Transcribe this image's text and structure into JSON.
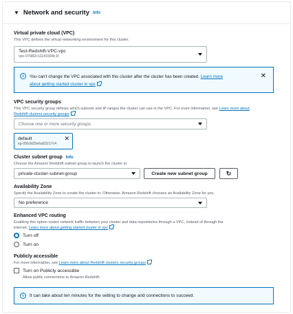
{
  "section": {
    "title": "Network and security",
    "info": "Info"
  },
  "vpc": {
    "label": "Virtual private cloud (VPC)",
    "description": "This VPC defines the virtual networking environment for this cluster.",
    "selected_name": "Test-Redshift-VPC-vpc",
    "selected_id": "vpc-07982c11141594c1f"
  },
  "vpc_alert": {
    "text": "You can't change the VPC associated with this cluster after the cluster has been created.",
    "link_line1": "Learn more",
    "link_line2": "about getting started cluster in vpc"
  },
  "security_groups": {
    "label": "VPC security groups",
    "description": "This VPC security group defines which subnets and IP ranges the cluster can use in the VPC. For more information, see",
    "link_part1": "Learn more about",
    "link_part2": "Redshift clusters security groups",
    "placeholder": "Choose one or more security groups",
    "token_name": "default",
    "token_id": "sg-05b3d25e6a83217c4"
  },
  "subnet": {
    "label": "Cluster subnet group",
    "info": "Info",
    "description": "Choose the Amazon Redshift subnet group to launch the cluster in.",
    "selected": "private-cluster-subnet-group",
    "create_button": "Create new subnet group"
  },
  "az": {
    "label": "Availability Zone",
    "description": "Specify the Availability Zone to create the cluster in. Otherwise, Amazon Redshift chooses an Availability Zone for you.",
    "selected": "No preference"
  },
  "enhanced_routing": {
    "label": "Enhanced VPC routing",
    "description_line1": "Enabling this option routes network traffic between your cluster and data repositories through a VPC, instead of through the",
    "description_line2": "internet.",
    "link": "Learn more about getting started cluster in vpc",
    "options": [
      "Turn off",
      "Turn on"
    ],
    "selected": "Turn off"
  },
  "public": {
    "label": "Publicly accessible",
    "description": "For more information, see",
    "link": "Learn more about Redshift clusters security groups",
    "checkbox_label": "Turn on Publicly accessible",
    "checkbox_description": "Allow public connections to Amazon Redshift.",
    "checked": false
  },
  "bottom_alert": {
    "text": "It can take about ten minutes for the setting to change and connections to succeed."
  },
  "colors": {
    "link": "#0073bb",
    "alert_bg": "#f1faff",
    "text": "#16191f",
    "muted": "#545b64"
  }
}
